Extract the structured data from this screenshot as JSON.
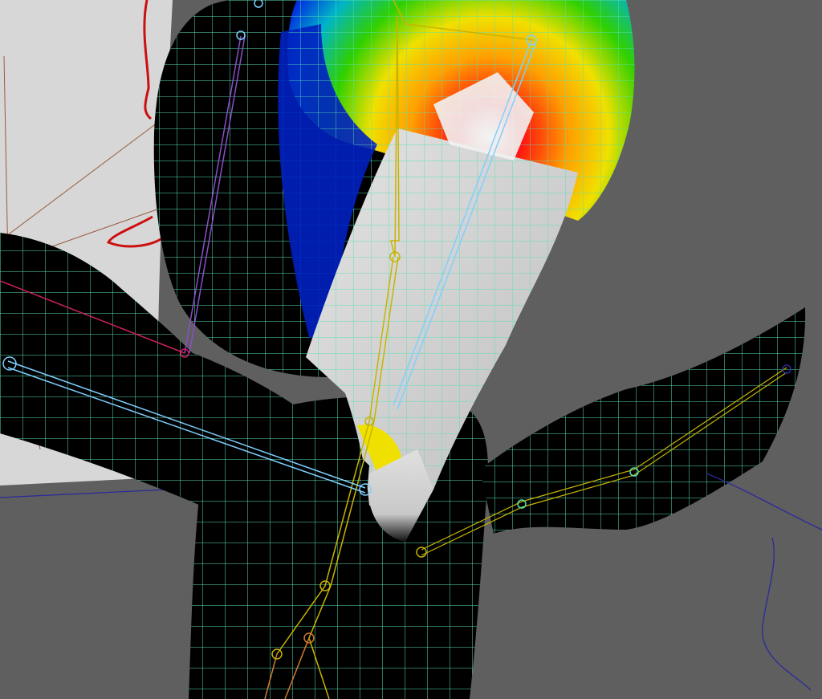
{
  "viewport": {
    "name": "3d-viewport",
    "mode": "weight-paint",
    "colors": {
      "background": "#5f5f5f",
      "backdrop_panel": "#d7d7d7",
      "mesh_fill": "#000000",
      "wireframe": "#59e0b2",
      "selected_mesh": "#d9d9d9",
      "weight_high": "#ff0000",
      "weight_mid_high": "#ffcc00",
      "weight_mid": "#33cc00",
      "weight_low": "#0000cc",
      "bone_cyan": "#7fd0ff",
      "bone_yellow": "#c8b400",
      "bone_purple": "#8a4fc8",
      "bone_orange": "#d07a30",
      "curve_red": "#cc1010",
      "curve_blue": "#2a2a9a"
    }
  }
}
